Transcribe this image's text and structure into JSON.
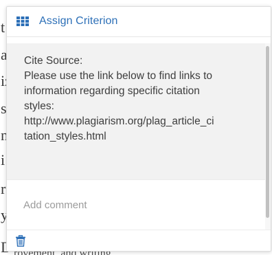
{
  "background_fragments": {
    "left_letters": [
      "t",
      "a",
      "iz",
      "s",
      "n",
      "i",
      "r",
      "y",
      "D"
    ],
    "bottom_text": "rovement, and writing."
  },
  "popup": {
    "header": {
      "icon": "grid-icon",
      "title": "Assign Criterion",
      "accent_color": "#2c6fb7"
    },
    "criterion": {
      "lines": [
        "Cite Source:",
        "Please use the link below to find links to",
        "information regarding specific citation",
        "styles:",
        "http://www.plagiarism.org/plag_article_ci",
        "tation_styles.html"
      ]
    },
    "comment": {
      "placeholder": "Add comment",
      "value": ""
    },
    "footer": {
      "delete_icon": "trash-icon",
      "delete_color": "#2c6fb7"
    }
  }
}
